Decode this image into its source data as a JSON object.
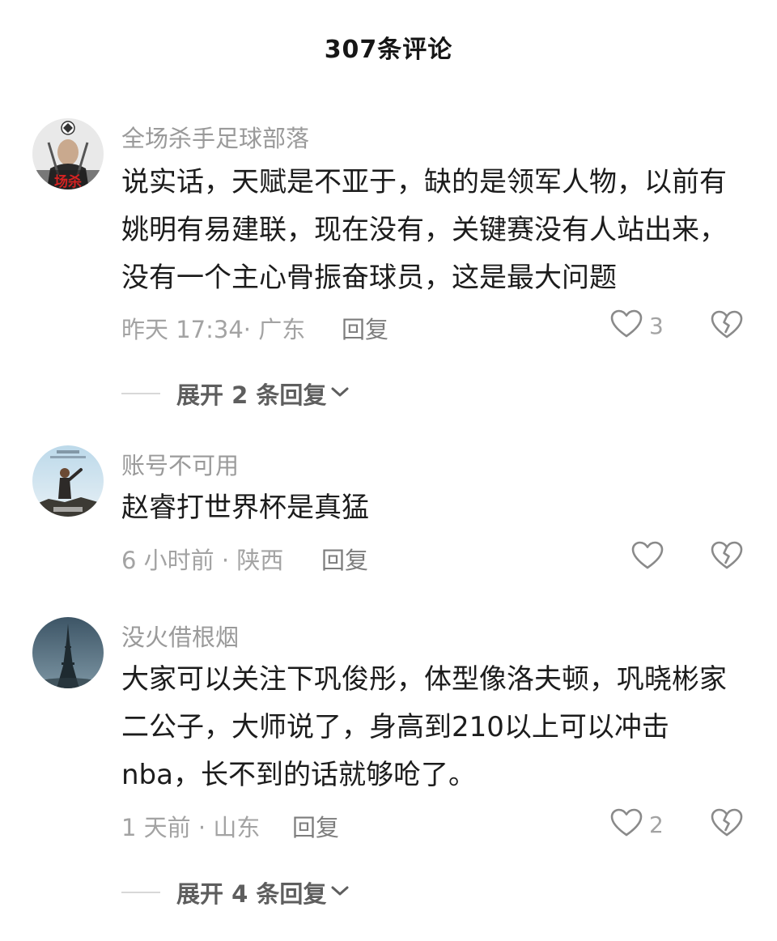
{
  "header": {
    "title": "307条评论"
  },
  "comments": [
    {
      "username": "全场杀手足球部落",
      "avatar_overlay_text": "场杀",
      "content": "说实话，天赋是不亚于，缺的是领军人物，以前有姚明有易建联，现在没有，关键赛没有人站出来，没有一个主心骨振奋球员，这是最大问题",
      "meta": "昨天 17:34· 广东",
      "reply_label": "回复",
      "like_count": "3",
      "expand_label": "展开 2 条回复"
    },
    {
      "username": "账号不可用",
      "content": "赵睿打世界杯是真猛",
      "meta": "6 小时前 · 陕西",
      "reply_label": "回复",
      "like_count": ""
    },
    {
      "username": "没火借根烟",
      "content": "大家可以关注下巩俊彤，体型像洛夫顿，巩晓彬家二公子，大师说了，身高到210以上可以冲击nba，长不到的话就够呛了。",
      "meta": "1 天前 · 山东",
      "reply_label": "回复",
      "like_count": "2",
      "expand_label": "展开 4 条回复"
    }
  ],
  "colors": {
    "text_primary": "#1c1c1c",
    "text_secondary": "#9a9a9a",
    "icon_stroke": "#8a8a8a"
  },
  "icons": {
    "like": "heart-outline-icon",
    "dislike": "broken-heart-icon",
    "expand": "chevron-down-icon"
  }
}
